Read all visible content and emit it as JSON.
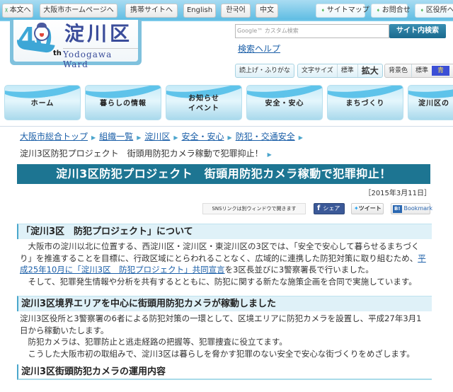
{
  "topbar": {
    "skip_link": "本文へ",
    "buttons": [
      "大阪市ホームページへ",
      "携帯サイトへ",
      "English",
      "한국어",
      "中文"
    ],
    "links": [
      "サイトマップ",
      "お問合せ",
      "区役所への"
    ]
  },
  "logo": {
    "anniversary": "40",
    "anniversary_suffix": "th",
    "name_jp": "淀川区",
    "name_en": "Yodogawa Ward"
  },
  "search": {
    "placeholder": "Google™ カスタム検索",
    "button": "サイト内検索",
    "help": "検索ヘルプ"
  },
  "accessibility": {
    "read_aloud": "読上げ・ふりがな",
    "text_size_label": "文字サイズ",
    "text_size_standard": "標準",
    "text_size_large": "拡大",
    "bg_color_label": "背景色",
    "bg_color_standard": "標準",
    "bg_color_blue": "青"
  },
  "nav": {
    "tabs": [
      {
        "line1": "ホーム",
        "line2": ""
      },
      {
        "line1": "暮らしの情報",
        "line2": ""
      },
      {
        "line1": "お知らせ",
        "line2": "イベント"
      },
      {
        "line1": "安全・安心",
        "line2": ""
      },
      {
        "line1": "まちづくり",
        "line2": ""
      },
      {
        "line1": "淀川区の",
        "line2": ""
      }
    ]
  },
  "breadcrumb": {
    "items": [
      "大阪市総合トップ",
      "組織一覧",
      "淀川区",
      "安全・安心",
      "防犯・交通安全"
    ],
    "current": "淀川3区防犯プロジェクト　街頭用防犯カメラ稼動で犯罪抑止！"
  },
  "article": {
    "title": "淀川3区防犯プロジェクト　街頭用防犯カメラ稼動で犯罪抑止！",
    "date": "［2015年3月11日］",
    "sns": {
      "note": "SNSリンクは別ウィンドウで開きます",
      "facebook": "シェア",
      "twitter": "ツイート",
      "hatena": "Bookmark"
    },
    "sections": [
      {
        "heading": "「淀川3区　防犯プロジェクト」について",
        "line1": "　大阪市の淀川以北に位置する、西淀川区・淀川区・東淀川区の3区では、「安全で安心して暮らせるまちづく",
        "line2a": "り」を推進することを目標に、行政区域にとらわれることなく、広域的に連携した防犯対策に取り組むため、",
        "line2_link": "平",
        "line3_link": "成25年10月に「淀川3区　防犯プロジェクト」共同宣言",
        "line3b": "を3区長並びに3警察署長で行いました。",
        "line4": "　そして、犯罪発生情報や分析を共有するとともに、防犯に関する新たな施策企画を合同で実施しています。"
      },
      {
        "heading": "淀川3区境界エリアを中心に街頭用防犯カメラが稼動しました",
        "line1": "淀川3区役所と3警察署の6者による防犯対策の一環として、区境エリアに防犯カメラを設置し、平成27年3月1",
        "line2": "日から稼動いたします。",
        "line3": "　防犯カメラは、犯罪防止と逃走経路の把握等、犯罪捜査に役立てます。",
        "line4": "　こうした大阪市初の取組みで、淀川3区は暮らしを脅かす犯罪のない安全で安心な街づくりをめざします。"
      },
      {
        "heading": "淀川3区街頭防犯カメラの運用内容"
      }
    ]
  }
}
